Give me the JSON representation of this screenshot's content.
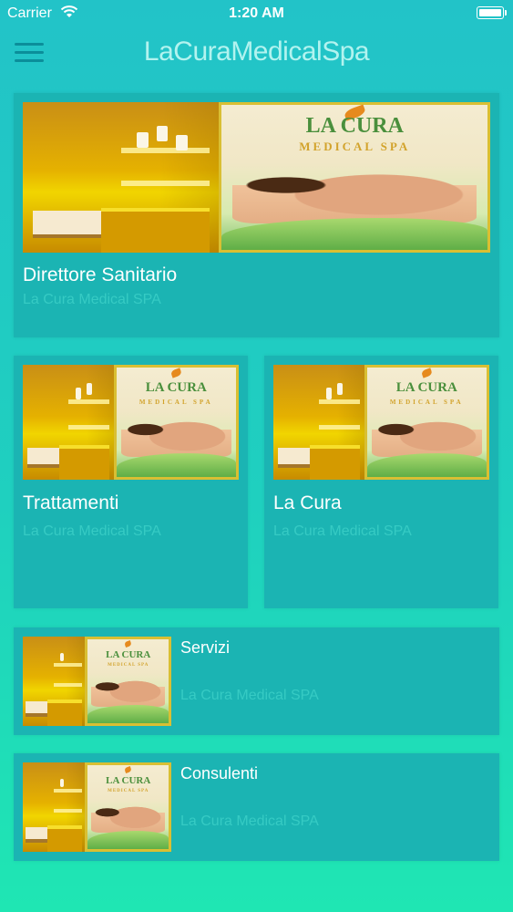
{
  "status_bar": {
    "carrier": "Carrier",
    "time": "1:20 AM"
  },
  "nav": {
    "title": "LaCuraMedicalSpa",
    "menu_icon": "hamburger-menu-icon"
  },
  "image": {
    "brand": "LA CURA",
    "brand_sub": "MEDICAL SPA"
  },
  "cards": [
    {
      "title": "Direttore Sanitario",
      "subtitle": "La Cura Medical SPA"
    },
    {
      "title": "Trattamenti",
      "subtitle": "La Cura Medical SPA"
    },
    {
      "title": "La Cura",
      "subtitle": "La Cura Medical SPA"
    },
    {
      "title": "Servizi",
      "subtitle": "La Cura Medical SPA"
    },
    {
      "title": "Consulenti",
      "subtitle": "La Cura Medical SPA"
    }
  ],
  "colors": {
    "background_top": "#22c3c8",
    "background_bottom": "#1fe6b3",
    "card": "#1bb4b3",
    "subtitle": "#36cbc4"
  }
}
